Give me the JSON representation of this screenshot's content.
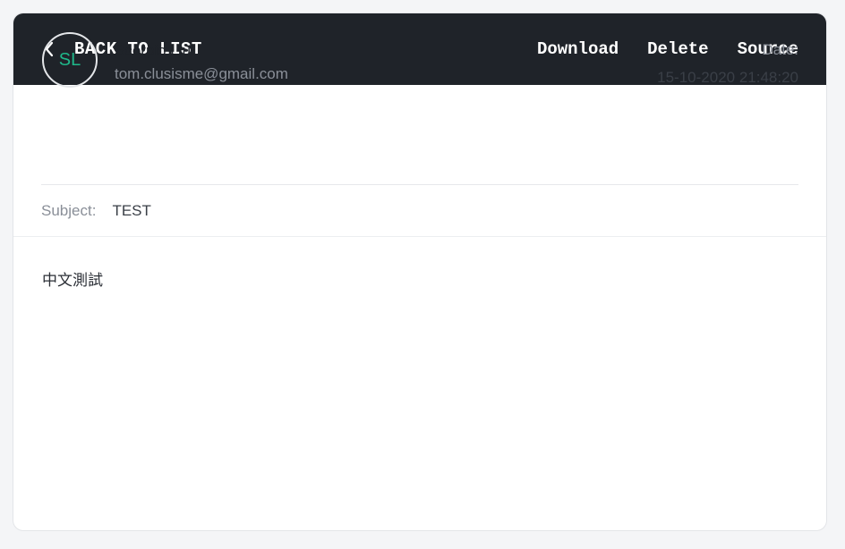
{
  "header": {
    "back_label": "BACK TO LIST",
    "actions": [
      "Download",
      "Delete",
      "Source"
    ]
  },
  "sender": {
    "initials": "SL",
    "name": "Scorpio Liu",
    "email": "tom.clusisme@gmail.com"
  },
  "date": {
    "label": "Date:",
    "value": "15-10-2020 21:48:20"
  },
  "subject": {
    "label": "Subject:",
    "value": "TEST"
  },
  "body": {
    "text": "中文測試"
  },
  "colors": {
    "header_bg": "#1f2329",
    "avatar_text": "#1fb88a"
  }
}
